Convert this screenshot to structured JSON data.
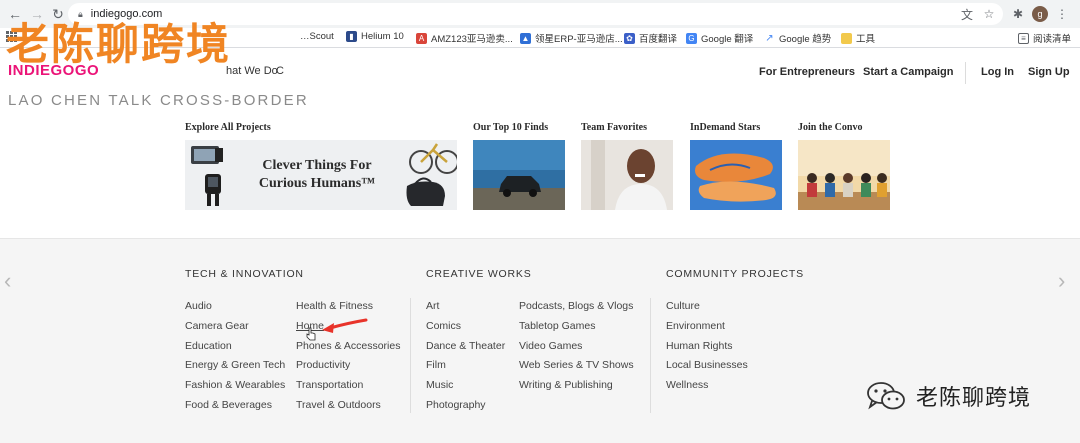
{
  "browser": {
    "url": "indiegogo.com",
    "profile_initial": "g",
    "bookmarks": [
      {
        "label": "…Scout"
      },
      {
        "label": "Helium 10"
      },
      {
        "label": "AMZ123亚马逊卖..."
      },
      {
        "label": "领星ERP-亚马逊店..."
      },
      {
        "label": "百度翻译"
      },
      {
        "label": "Google 翻译"
      },
      {
        "label": "Google 趋势"
      },
      {
        "label": "工具"
      },
      {
        "label": "阅读清单"
      }
    ]
  },
  "header": {
    "logo": "INDIEGOGO",
    "nav_partial_1": "hat We Do",
    "nav_partial_2": "C",
    "for_entrepreneurs": "For Entrepreneurs",
    "start_campaign": "Start a Campaign",
    "login": "Log In",
    "signup": "Sign Up"
  },
  "watermark": {
    "title": "老陈聊跨境",
    "subtitle": "LAO CHEN TALK CROSS-BORDER",
    "bottom_text": "老陈聊跨境"
  },
  "featured": {
    "explore_label": "Explore All Projects",
    "banner_text_1": "Clever Things For",
    "banner_text_2": "Curious Humans™",
    "tiles": [
      {
        "label": "Our Top 10 Finds"
      },
      {
        "label": "Team Favorites"
      },
      {
        "label": "InDemand Stars"
      },
      {
        "label": "Join the Convo"
      }
    ]
  },
  "footer": {
    "tech": {
      "heading": "TECH & INNOVATION",
      "left": [
        "Audio",
        "Camera Gear",
        "Education",
        "Energy & Green Tech",
        "Fashion & Wearables",
        "Food & Beverages"
      ],
      "right": [
        "Health & Fitness",
        "Home",
        "Phones & Accessories",
        "Productivity",
        "Transportation",
        "Travel & Outdoors"
      ]
    },
    "creative": {
      "heading": "CREATIVE WORKS",
      "left": [
        "Art",
        "Comics",
        "Dance & Theater",
        "Film",
        "Music",
        "Photography"
      ],
      "right": [
        "Podcasts, Blogs & Vlogs",
        "Tabletop Games",
        "Video Games",
        "Web Series & TV Shows",
        "Writing & Publishing"
      ]
    },
    "community": {
      "heading": "COMMUNITY PROJECTS",
      "items": [
        "Culture",
        "Environment",
        "Human Rights",
        "Local Businesses",
        "Wellness"
      ]
    }
  },
  "colors": {
    "brand": "#eb1478",
    "watermark": "#f08523",
    "annotation_arrow": "#e8332a"
  }
}
